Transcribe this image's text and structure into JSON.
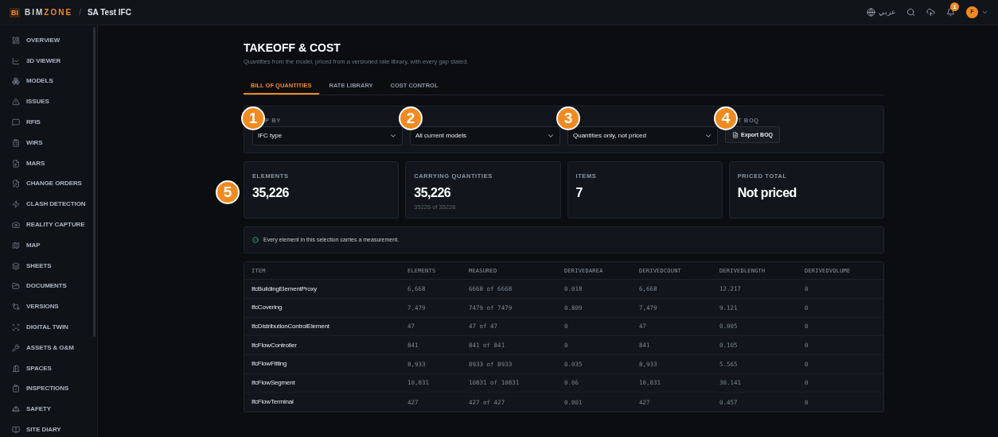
{
  "topbar": {
    "logo_mark": "BI",
    "logo_a": "BIM",
    "logo_b": "ZONE",
    "separator": "/",
    "project": "SA Test IFC",
    "language": "عربي",
    "notifications": "1",
    "avatar": "F"
  },
  "sidebar": {
    "items": [
      {
        "label": "OVERVIEW"
      },
      {
        "label": "3D VIEWER"
      },
      {
        "label": "MODELS"
      },
      {
        "label": "ISSUES"
      },
      {
        "label": "RFIS"
      },
      {
        "label": "WIRS"
      },
      {
        "label": "MARS"
      },
      {
        "label": "CHANGE ORDERS"
      },
      {
        "label": "CLASH DETECTION"
      },
      {
        "label": "REALITY CAPTURE"
      },
      {
        "label": "MAP"
      },
      {
        "label": "SHEETS"
      },
      {
        "label": "DOCUMENTS"
      },
      {
        "label": "VERSIONS"
      },
      {
        "label": "DIGITAL TWIN"
      },
      {
        "label": "ASSETS & O&M"
      },
      {
        "label": "SPACES"
      },
      {
        "label": "INSPECTIONS"
      },
      {
        "label": "SAFETY"
      },
      {
        "label": "SITE DIARY"
      }
    ]
  },
  "page": {
    "title": "TAKEOFF & COST",
    "subtitle": "Quantities from the model, priced from a versioned rate library, with every gap stated."
  },
  "tabs": [
    {
      "label": "BILL OF QUANTITIES",
      "selected": true
    },
    {
      "label": "RATE LIBRARY",
      "selected": false
    },
    {
      "label": "COST CONTROL",
      "selected": false
    }
  ],
  "filters": [
    {
      "kind": "select",
      "label": "P BY",
      "value": "IFC type",
      "callout": "1"
    },
    {
      "kind": "select",
      "value": "All current models",
      "callout": "2"
    },
    {
      "kind": "select",
      "value": "Quantities only, not priced",
      "callout": "3"
    },
    {
      "kind": "button",
      "label": "T BOQ",
      "value": "Export BOQ",
      "callout": "4"
    }
  ],
  "stats": [
    {
      "label": "ELEMENTS",
      "value": "35,226",
      "callout": "5"
    },
    {
      "label": "CARRYING QUANTITIES",
      "value": "35,226",
      "note": "35226 of 35226"
    },
    {
      "label": "ITEMS",
      "value": "7"
    },
    {
      "label": "PRICED TOTAL",
      "value": "Not priced"
    }
  ],
  "notice": "Every element in this selection carries a measurement.",
  "table": {
    "columns": [
      "ITEM",
      "ELEMENTS",
      "MEASURED",
      "DERIVEDAREA",
      "DERIVEDCOUNT",
      "DERIVEDLENGTH",
      "DERIVEDVOLUME"
    ],
    "rows": [
      [
        "IfcBuildingElementProxy",
        "6,668",
        "6668 of 6668",
        "0.018",
        "6,668",
        "12.217",
        "0"
      ],
      [
        "IfcCovering",
        "7,479",
        "7479 of 7479",
        "0.809",
        "7,479",
        "9.121",
        "0"
      ],
      [
        "IfcDistributionControlElement",
        "47",
        "47 of 47",
        "0",
        "47",
        "0.005",
        "0"
      ],
      [
        "IfcFlowController",
        "841",
        "841 of 841",
        "0",
        "841",
        "0.105",
        "0"
      ],
      [
        "IfcFlowFitting",
        "8,933",
        "8933 of 8933",
        "0.035",
        "8,933",
        "5.565",
        "0"
      ],
      [
        "IfcFlowSegment",
        "10,831",
        "10831 of 10831",
        "0.06",
        "10,831",
        "30.141",
        "0"
      ],
      [
        "IfcFlowTerminal",
        "427",
        "427 of 427",
        "0.001",
        "427",
        "0.457",
        "0"
      ]
    ]
  }
}
